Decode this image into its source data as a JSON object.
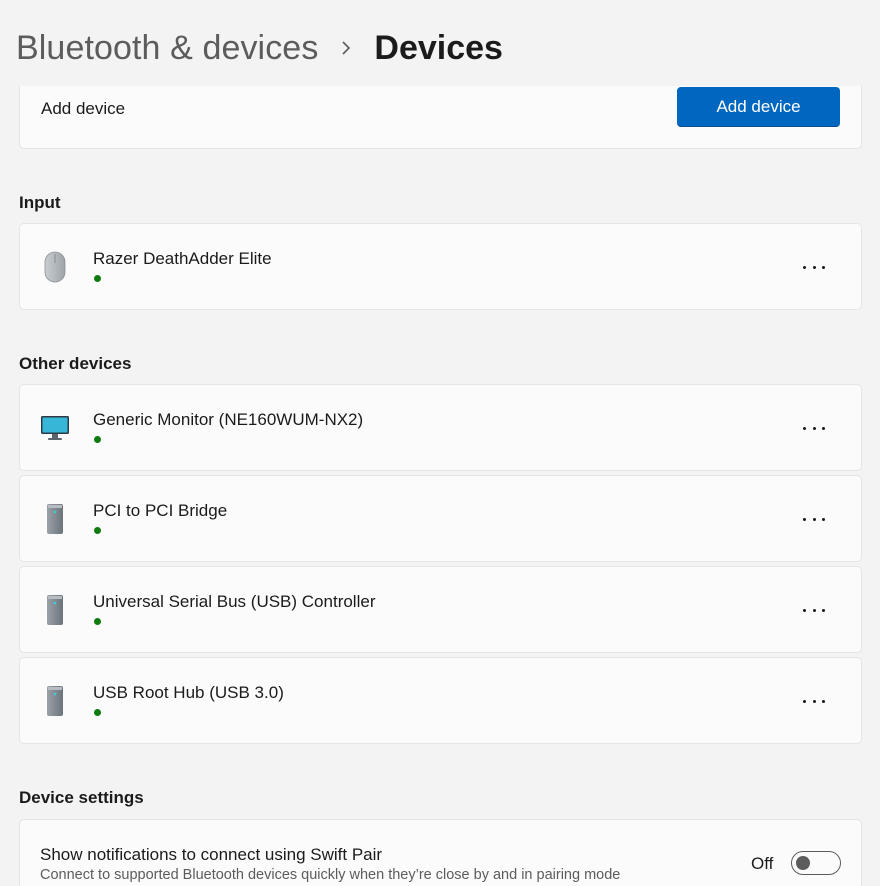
{
  "breadcrumb": {
    "parent": "Bluetooth & devices",
    "current": "Devices"
  },
  "add_device": {
    "label": "Add device",
    "button": "Add device"
  },
  "sections": {
    "input": "Input",
    "other": "Other devices",
    "settings": "Device settings"
  },
  "input_devices": [
    {
      "name": "Razer DeathAdder Elite",
      "icon": "mouse-icon",
      "status": "connected"
    }
  ],
  "other_devices": [
    {
      "name": "Generic Monitor (NE160WUM-NX2)",
      "icon": "monitor-icon",
      "status": "connected"
    },
    {
      "name": "PCI to PCI Bridge",
      "icon": "pc-tower-icon",
      "status": "connected"
    },
    {
      "name": "Universal Serial Bus (USB) Controller",
      "icon": "pc-tower-icon",
      "status": "connected"
    },
    {
      "name": "USB Root Hub (USB 3.0)",
      "icon": "pc-tower-icon",
      "status": "connected"
    }
  ],
  "swift_pair": {
    "title": "Show notifications to connect using Swift Pair",
    "description": "Connect to supported Bluetooth devices quickly when they’re close by and in pairing mode",
    "state_label": "Off",
    "enabled": false
  },
  "colors": {
    "accent": "#0067c0",
    "status_connected": "#0f7b0f",
    "background": "#f3f3f3",
    "card": "#fbfbfb"
  }
}
